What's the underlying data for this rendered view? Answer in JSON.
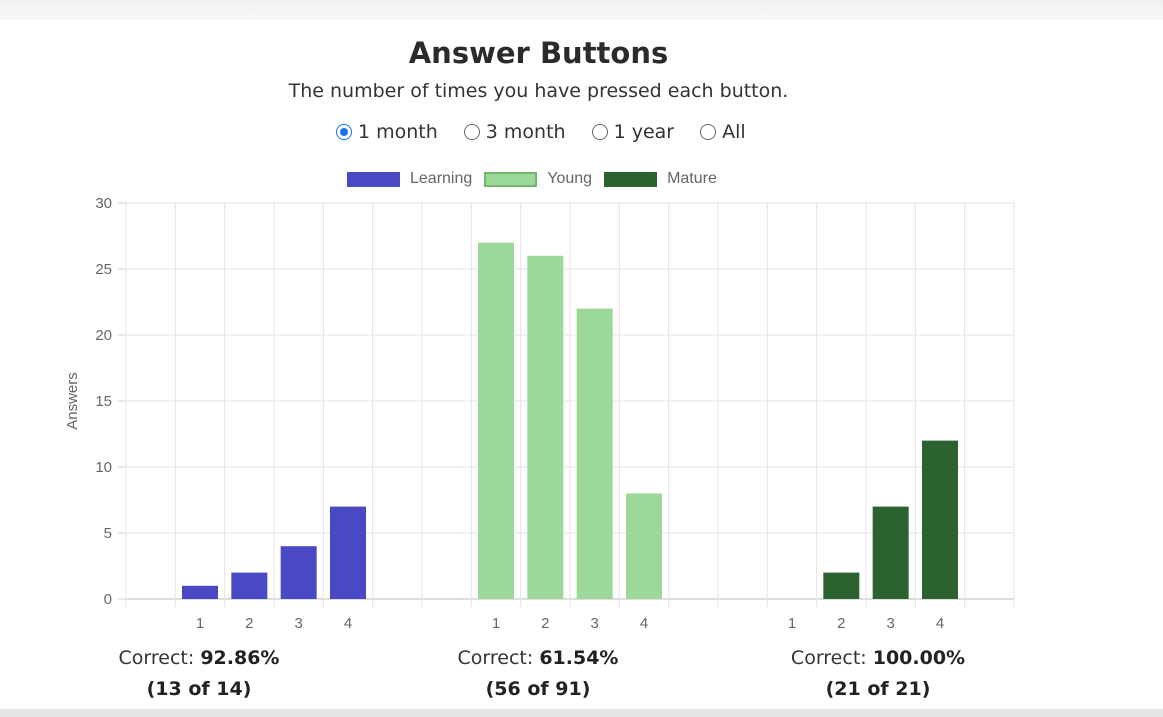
{
  "header": {
    "title": "Answer Buttons",
    "subtitle": "The number of times you have pressed each button."
  },
  "ranges": [
    {
      "label": "1 month",
      "selected": true
    },
    {
      "label": "3 month",
      "selected": false
    },
    {
      "label": "1 year",
      "selected": false
    },
    {
      "label": "All",
      "selected": false
    }
  ],
  "legend": [
    {
      "label": "Learning",
      "color": "#4a49c4",
      "border": "#4a49c4",
      "fill": "#4a49c4"
    },
    {
      "label": "Young",
      "color": "#9bd899",
      "border": "#6fb86d",
      "fill": "#9bd899"
    },
    {
      "label": "Mature",
      "color": "#2c622f",
      "border": "#2c622f",
      "fill": "#2c622f"
    }
  ],
  "chart_data": {
    "type": "bar",
    "ylabel": "Answers",
    "ylim": [
      0,
      30
    ],
    "yticks": [
      0,
      5,
      10,
      15,
      20,
      25,
      30
    ],
    "grid": true,
    "legend_position": "top",
    "groups": [
      {
        "name": "Learning",
        "color": "#4a49c4",
        "buttons": [
          "1",
          "2",
          "3",
          "4"
        ],
        "values": [
          1,
          2,
          4,
          7
        ]
      },
      {
        "name": "Young",
        "color": "#9bd899",
        "buttons": [
          "1",
          "2",
          "3",
          "4"
        ],
        "values": [
          27,
          26,
          22,
          8
        ]
      },
      {
        "name": "Mature",
        "color": "#2c622f",
        "buttons": [
          "1",
          "2",
          "3",
          "4"
        ],
        "values": [
          0,
          2,
          7,
          12
        ]
      }
    ]
  },
  "correct": [
    {
      "prefix": "Correct: ",
      "percent": "92.86%",
      "detail": "(13 of 14)"
    },
    {
      "prefix": "Correct: ",
      "percent": "61.54%",
      "detail": "(56 of 91)"
    },
    {
      "prefix": "Correct: ",
      "percent": "100.00%",
      "detail": "(21 of 21)"
    }
  ]
}
